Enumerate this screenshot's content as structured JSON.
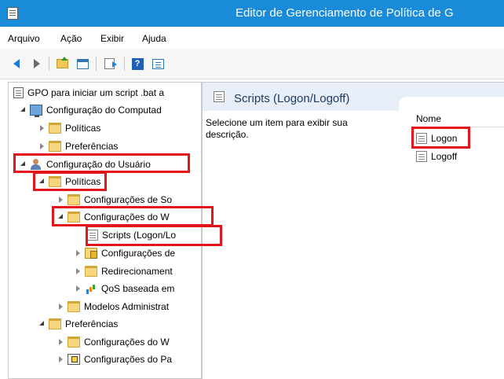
{
  "window": {
    "title": "Editor de Gerenciamento de Política de G"
  },
  "menu": [
    "Arquivo",
    "Ação",
    "Exibir",
    "Ajuda"
  ],
  "toolbar": {
    "buttons": [
      "back-icon",
      "forward-icon",
      "up-folder-icon",
      "show-hide-console-tree-icon",
      "export-list-icon",
      "help-icon",
      "properties-icon"
    ]
  },
  "tree": {
    "root": "GPO para iniciar um script .bat a",
    "computer_config": "Configuração do Computad",
    "computer_policies": "Políticas",
    "computer_preferences": "Preferências",
    "user_config": "Configuração do Usuário",
    "user_policies": "Políticas",
    "software_settings": "Configurações de So",
    "windows_settings": "Configurações do W",
    "scripts": "Scripts (Logon/Lo",
    "security_settings": "Configurações de",
    "folder_redirection": "Redirecionament",
    "qos": "QoS baseada em",
    "admin_templates": "Modelos Administrat",
    "user_preferences": "Preferências",
    "pref_windows_settings": "Configurações do W",
    "pref_control_panel": "Configurações do Pa"
  },
  "details": {
    "title": "Scripts (Logon/Logoff)",
    "description": "Selecione um item para exibir sua descrição.",
    "column_name": "Nome",
    "items": [
      "Logon",
      "Logoff"
    ]
  },
  "colors": {
    "titlebar": "#1a8bd8",
    "highlight": "#e3141a",
    "header_band": "#e8eef7"
  }
}
